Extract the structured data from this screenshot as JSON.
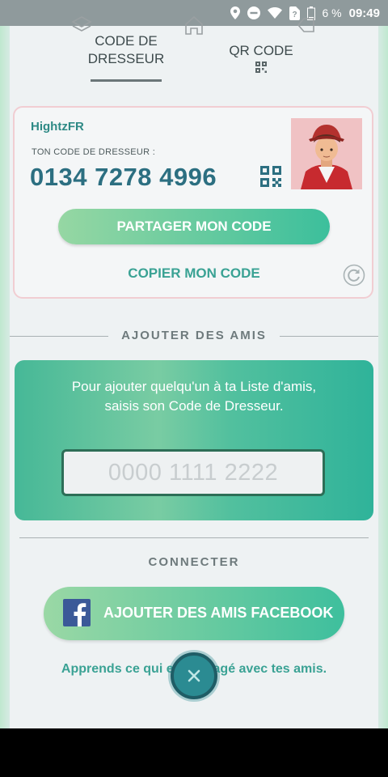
{
  "status_bar": {
    "battery_percent": "6 %",
    "time": "09:49",
    "icons": [
      "location-icon",
      "do-not-disturb-icon",
      "wifi-icon",
      "no-sim-icon",
      "battery-low-icon"
    ]
  },
  "tabs": [
    {
      "label_line1": "CODE DE",
      "label_line2": "DRESSEUR",
      "active": true
    },
    {
      "label": "QR CODE",
      "active": false
    }
  ],
  "trainer_card": {
    "username": "HightzFR",
    "code_label": "TON CODE DE DRESSEUR :",
    "code": "0134 7278 4996",
    "share_button": "PARTAGER MON CODE",
    "copy_button": "COPIER MON CODE"
  },
  "add_friends": {
    "title": "AJOUTER DES AMIS",
    "instructions": "Pour ajouter quelqu'un à ta Liste d'amis, saisis son Code de Dresseur.",
    "input_value": "",
    "input_placeholder": "0000 1111 2222"
  },
  "connect": {
    "title": "CONNECTER",
    "facebook_button": "AJOUTER DES AMIS FACEBOOK",
    "learn_link": "Apprends ce qui est partagé avec tes amis."
  },
  "colors": {
    "accent_teal": "#3aa294",
    "code_blue": "#2c6f81",
    "facebook_blue": "#3b5998",
    "button_gradient_start": "#96d7a3",
    "button_gradient_end": "#3cbf9c"
  },
  "nav_bar": {
    "icons": [
      "recent-apps-icon",
      "home-icon",
      "back-icon"
    ]
  }
}
